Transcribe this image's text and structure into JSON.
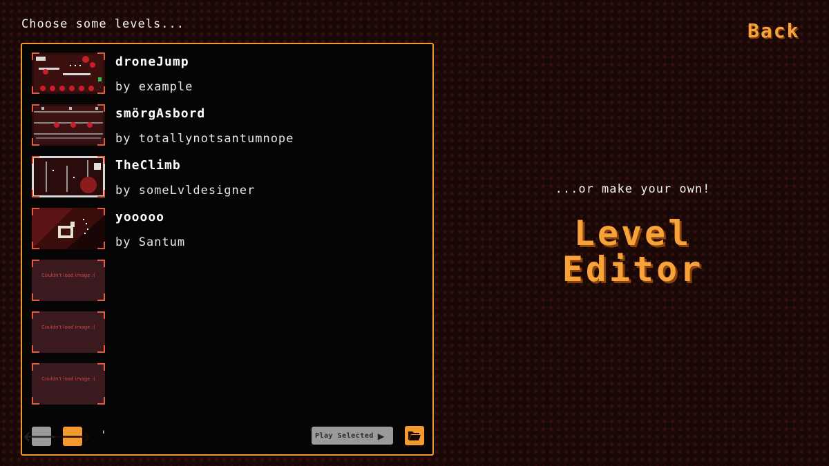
{
  "header": {
    "prompt": "Choose some levels...",
    "back_label": "Back"
  },
  "levels": [
    {
      "name": "droneJump",
      "author": "by example"
    },
    {
      "name": "smörgAsbord",
      "author": "by totallynotsantumnope"
    },
    {
      "name": "TheClimb",
      "author": "by someLvldesigner"
    },
    {
      "name": "yooooo",
      "author": "by Santum"
    }
  ],
  "failed_thumbnails": [
    {
      "text": "Couldn't load image :("
    },
    {
      "text": "Couldn't load image :("
    },
    {
      "text": "Couldn't load image :("
    }
  ],
  "footer": {
    "prev_icon": "arrow-left-icon",
    "next_icon": "arrow-right-icon",
    "page_indicator": "'",
    "play_label": "Play Selected",
    "play_icon": "play-icon",
    "folder_icon": "folder-open-icon"
  },
  "side": {
    "own_text": "...or make your own!",
    "editor_line1": "Level",
    "editor_line2": "Editor"
  },
  "colors": {
    "accent": "#f29a2f",
    "accent_text": "#f7a33a",
    "background": "#1a0806",
    "panel": "#050505",
    "button_gray": "#9a9a9a",
    "failed_thumb": "#3a1a1e",
    "failed_text": "#d2484a"
  }
}
